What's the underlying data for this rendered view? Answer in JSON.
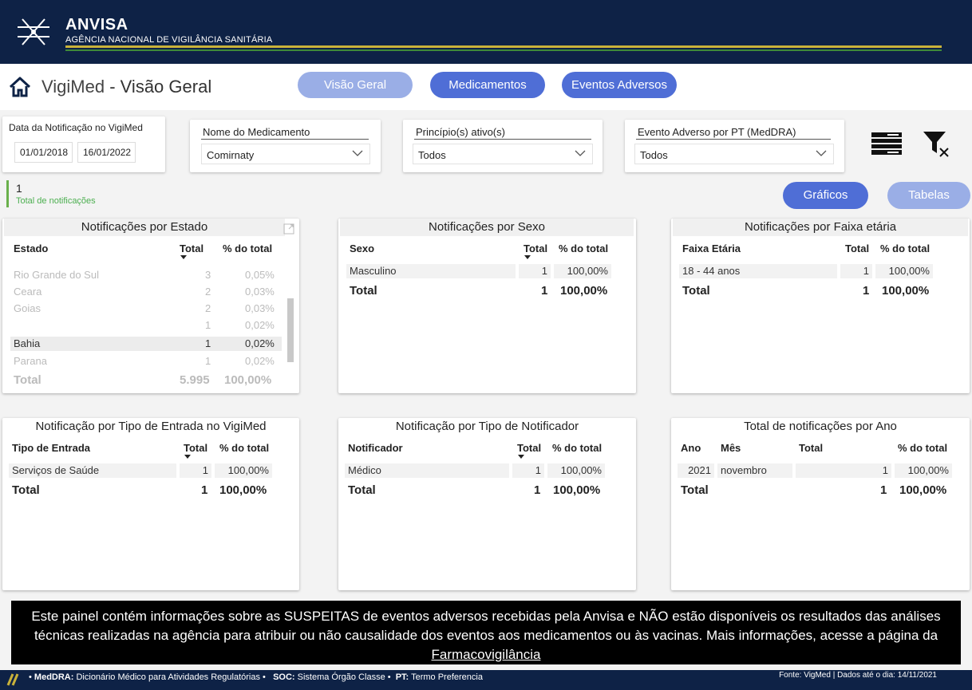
{
  "header": {
    "brand": "ANVISA",
    "brand_sub": "AGÊNCIA NACIONAL DE VIGILÂNCIA SANITÁRIA"
  },
  "title": {
    "app": "VigiMed",
    "separator": " - ",
    "page": "Visão Geral"
  },
  "nav": {
    "visao_geral": "Visão Geral",
    "medicamentos": "Medicamentos",
    "eventos_adversos": "Eventos Adversos"
  },
  "filters": {
    "date": {
      "label": "Data da Notificação no VigiMed",
      "from": "01/01/2018",
      "to": "16/01/2022"
    },
    "medicamento": {
      "label": "Nome do Medicamento",
      "value": "Comirnaty"
    },
    "principio": {
      "label": "Princípio(s) ativo(s)",
      "value": "Todos"
    },
    "evento": {
      "label": "Evento Adverso por PT (MedDRA)",
      "value": "Todos"
    }
  },
  "kpi": {
    "value": "1",
    "label": "Total de notificações"
  },
  "view_toggle": {
    "graficos": "Gráficos",
    "tabelas": "Tabelas"
  },
  "colors": {
    "navy": "#0e2246",
    "accent_blue": "#4f6ed6",
    "light_blue": "#9aaee6",
    "green": "#4caf50",
    "gold": "#c9b23a"
  },
  "cards": {
    "estado": {
      "title": "Notificações por Estado",
      "headers": [
        "Estado",
        "Total",
        "% do total"
      ],
      "rows": [
        {
          "label": "Rio Grande do Sul",
          "total": "3",
          "pct": "0,05%",
          "faded": true
        },
        {
          "label": "Ceara",
          "total": "2",
          "pct": "0,03%",
          "faded": true
        },
        {
          "label": "Goias",
          "total": "2",
          "pct": "0,03%",
          "faded": true
        },
        {
          "label": "",
          "total": "1",
          "pct": "0,02%",
          "faded": true
        },
        {
          "label": "Bahia",
          "total": "1",
          "pct": "0,02%",
          "faded": false
        },
        {
          "label": "Parana",
          "total": "1",
          "pct": "0,02%",
          "faded": true
        }
      ],
      "total": {
        "label": "Total",
        "total": "5.995",
        "pct": "100,00%"
      }
    },
    "sexo": {
      "title": "Notificações por Sexo",
      "headers": [
        "Sexo",
        "Total",
        "% do total"
      ],
      "rows": [
        {
          "label": "Masculino",
          "total": "1",
          "pct": "100,00%"
        }
      ],
      "total": {
        "label": "Total",
        "total": "1",
        "pct": "100,00%"
      }
    },
    "faixa": {
      "title": "Notificações por Faixa etária",
      "headers": [
        "Faixa Etária",
        "Total",
        "% do total"
      ],
      "rows": [
        {
          "label": "18 - 44 anos",
          "total": "1",
          "pct": "100,00%"
        }
      ],
      "total": {
        "label": "Total",
        "total": "1",
        "pct": "100,00%"
      }
    },
    "entrada": {
      "title": "Notificação por Tipo de Entrada no VigiMed",
      "headers": [
        "Tipo de Entrada",
        "Total",
        "% do total"
      ],
      "rows": [
        {
          "label": "Serviços de Saúde",
          "total": "1",
          "pct": "100,00%"
        }
      ],
      "total": {
        "label": "Total",
        "total": "1",
        "pct": "100,00%"
      }
    },
    "notificador": {
      "title": "Notificação por Tipo de Notificador",
      "headers": [
        "Notificador",
        "Total",
        "% do total"
      ],
      "rows": [
        {
          "label": "Médico",
          "total": "1",
          "pct": "100,00%"
        }
      ],
      "total": {
        "label": "Total",
        "total": "1",
        "pct": "100,00%"
      }
    },
    "ano": {
      "title": "Total de notificações por Ano",
      "headers": [
        "Ano",
        "Mês",
        "Total",
        "% do total"
      ],
      "rows": [
        {
          "ano": "2021",
          "mes": "novembro",
          "total": "1",
          "pct": "100,00%"
        }
      ],
      "total": {
        "label": "Total",
        "total": "1",
        "pct": "100,00%"
      }
    }
  },
  "disclaimer": {
    "text": "Este painel contém informações sobre as SUSPEITAS de eventos adversos recebidas pela Anvisa e NÃO estão disponíveis os resultados das análises técnicas realizadas na agência para atribuir ou não causalidade dos eventos aos medicamentos ou às vacinas. Mais informações, acesse a página da",
    "link": "Farmacovigilância"
  },
  "footer": {
    "meddra_key": "MedDRA:",
    "meddra_val": "Dicionário Médico para Atividades Regulatórias",
    "soc_key": "SOC:",
    "soc_val": "Sistema Órgão Classe",
    "pt_key": "PT:",
    "pt_val": "Termo Preferencia",
    "source": "Fonte: VigMed | Dados até o dia: 14/11/2021"
  }
}
